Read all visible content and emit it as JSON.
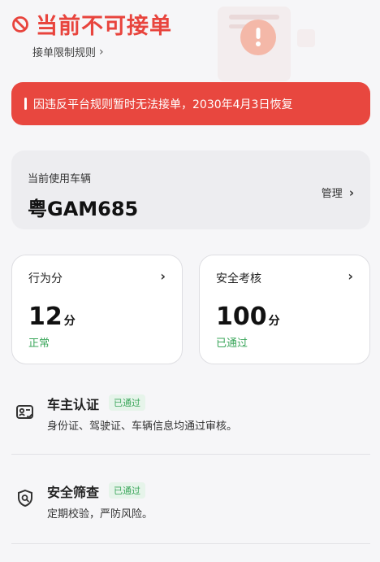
{
  "header": {
    "title": "当前不可接单",
    "rules_link": "接单限制规则",
    "accent_color": "#e8443d"
  },
  "alert": {
    "message": "因违反平台规则暂时无法接单，2030年4月3日恢复",
    "color": "#e8473f"
  },
  "vehicle": {
    "label": "当前使用车辆",
    "plate": "粤GAM685",
    "manage_label": "管理"
  },
  "cards": [
    {
      "title": "行为分",
      "value": "12",
      "unit": "分",
      "status": "正常"
    },
    {
      "title": "安全考核",
      "value": "100",
      "unit": "分",
      "status": "已通过"
    }
  ],
  "items": [
    {
      "icon": "id-card-check-icon",
      "name": "车主认证",
      "badge": "已通过",
      "desc": "身份证、驾驶证、车辆信息均通过审核。"
    },
    {
      "icon": "shield-search-icon",
      "name": "安全筛查",
      "badge": "已通过",
      "desc": "定期校验，严防风险。"
    }
  ],
  "status_color": "#3aa65a"
}
